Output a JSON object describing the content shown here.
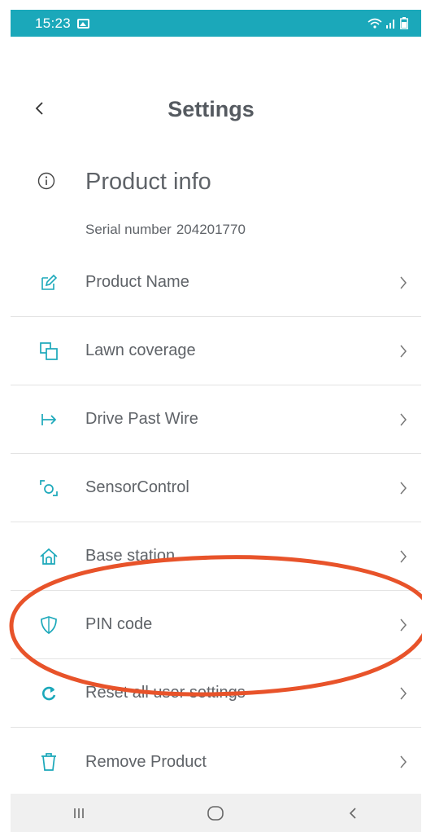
{
  "status_bar": {
    "time": "15:23"
  },
  "header": {
    "title": "Settings"
  },
  "product_info": {
    "title": "Product info",
    "serial_label": "Serial number",
    "serial_value": "204201770"
  },
  "menu": [
    {
      "label": "Product Name",
      "icon": "edit-icon"
    },
    {
      "label": "Lawn coverage",
      "icon": "overlap-squares-icon"
    },
    {
      "label": "Drive Past Wire",
      "icon": "arrow-right-bar-icon"
    },
    {
      "label": "SensorControl",
      "icon": "sensor-frame-icon"
    },
    {
      "label": "Base station",
      "icon": "home-icon"
    },
    {
      "label": "PIN code",
      "icon": "shield-icon"
    },
    {
      "label": "Reset all user settings",
      "icon": "reset-icon"
    },
    {
      "label": "Remove Product",
      "icon": "trash-icon"
    }
  ],
  "colors": {
    "accent": "#1ba8ba",
    "text": "#5f6368",
    "annotation": "#e8532a"
  }
}
